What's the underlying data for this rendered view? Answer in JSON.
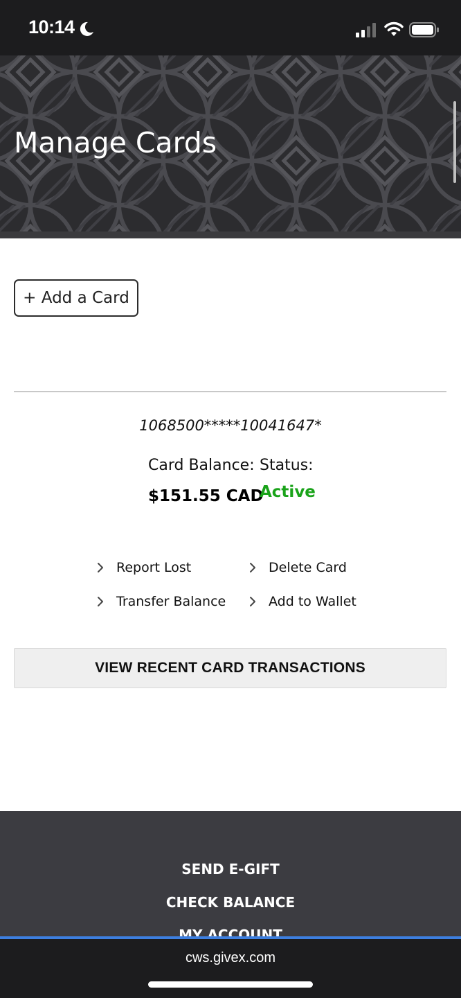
{
  "status_bar": {
    "time": "10:14",
    "icons": [
      "moon-icon",
      "signal-icon",
      "wifi-icon",
      "battery-icon"
    ]
  },
  "header": {
    "title": "Manage Cards"
  },
  "add_card": {
    "label": "+ Add a Card"
  },
  "card": {
    "number": "1068500*****10041647*",
    "balance_label": "Card Balance:",
    "balance_value": "$151.55 CAD",
    "status_label": "Status:",
    "status_value": "Active",
    "status_color": "#1aa31a"
  },
  "actions": {
    "report_lost": "Report Lost",
    "delete_card": "Delete Card",
    "transfer_balance": "Transfer Balance",
    "add_to_wallet": "Add to Wallet",
    "icon": "chevron-right-icon"
  },
  "transactions_button": {
    "label": "VIEW RECENT CARD TRANSACTIONS"
  },
  "footer": {
    "send_egift": "SEND E-GIFT",
    "check_balance": "CHECK BALANCE",
    "my_account": "MY ACCOUNT"
  },
  "browser": {
    "url": "cws.givex.com",
    "accent_color": "#3d7fe0"
  }
}
